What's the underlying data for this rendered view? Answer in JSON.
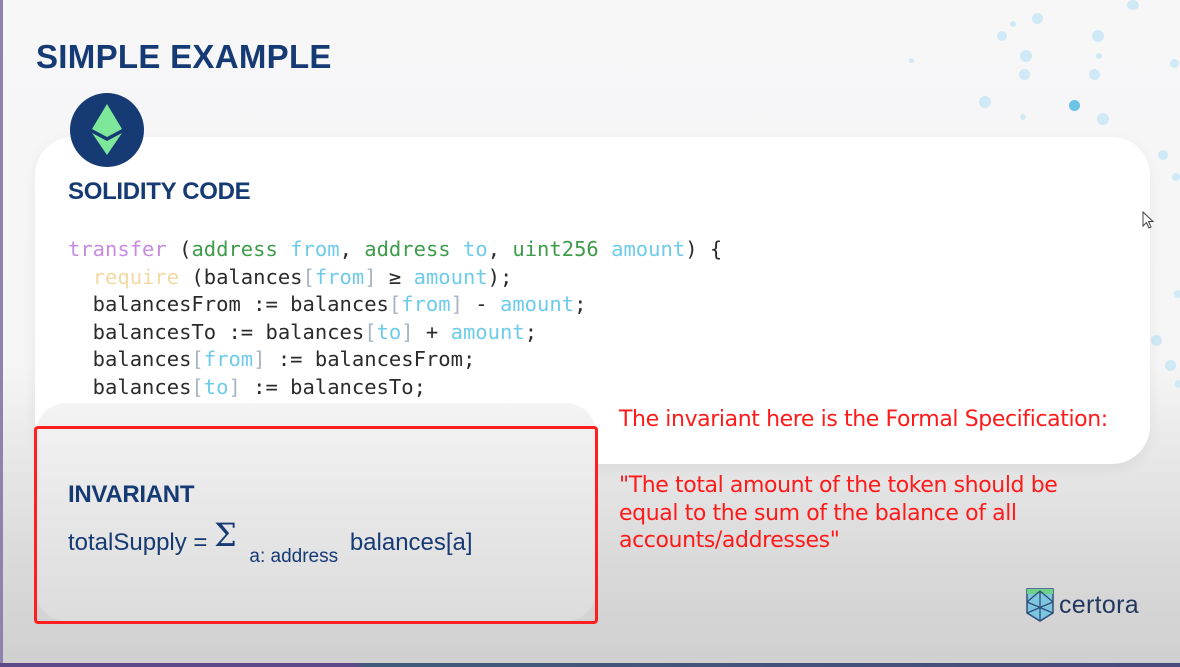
{
  "slide": {
    "title": "SIMPLE EXAMPLE",
    "code_section": {
      "heading": "SOLIDITY CODE",
      "lines": [
        [
          {
            "t": "transfer",
            "c": "c-fn"
          },
          {
            "t": " (",
            "c": ""
          },
          {
            "t": "address",
            "c": "c-type"
          },
          {
            "t": " ",
            "c": ""
          },
          {
            "t": "from",
            "c": "c-var"
          },
          {
            "t": ", ",
            "c": ""
          },
          {
            "t": "address",
            "c": "c-type"
          },
          {
            "t": " ",
            "c": ""
          },
          {
            "t": "to",
            "c": "c-var"
          },
          {
            "t": ", ",
            "c": ""
          },
          {
            "t": "uint256",
            "c": "c-type"
          },
          {
            "t": " ",
            "c": ""
          },
          {
            "t": "amount",
            "c": "c-var"
          },
          {
            "t": ") {",
            "c": ""
          }
        ],
        [
          {
            "t": "  ",
            "c": ""
          },
          {
            "t": "require",
            "c": "c-req"
          },
          {
            "t": " (balances",
            "c": ""
          },
          {
            "t": "[",
            "c": "c-brk"
          },
          {
            "t": "from",
            "c": "c-var"
          },
          {
            "t": "]",
            "c": "c-brk"
          },
          {
            "t": " ≥ ",
            "c": ""
          },
          {
            "t": "amount",
            "c": "c-var"
          },
          {
            "t": ");",
            "c": ""
          }
        ],
        [
          {
            "t": "  balancesFrom := balances",
            "c": ""
          },
          {
            "t": "[",
            "c": "c-brk"
          },
          {
            "t": "from",
            "c": "c-var"
          },
          {
            "t": "]",
            "c": "c-brk"
          },
          {
            "t": " - ",
            "c": ""
          },
          {
            "t": "amount",
            "c": "c-var"
          },
          {
            "t": ";",
            "c": ""
          }
        ],
        [
          {
            "t": "  balancesTo := balances",
            "c": ""
          },
          {
            "t": "[",
            "c": "c-brk"
          },
          {
            "t": "to",
            "c": "c-var"
          },
          {
            "t": "]",
            "c": "c-brk"
          },
          {
            "t": " + ",
            "c": ""
          },
          {
            "t": "amount",
            "c": "c-var"
          },
          {
            "t": ";",
            "c": ""
          }
        ],
        [
          {
            "t": "  balances",
            "c": ""
          },
          {
            "t": "[",
            "c": "c-brk"
          },
          {
            "t": "from",
            "c": "c-var"
          },
          {
            "t": "]",
            "c": "c-brk"
          },
          {
            "t": " := balancesFrom;",
            "c": ""
          }
        ],
        [
          {
            "t": "  balances",
            "c": ""
          },
          {
            "t": "[",
            "c": "c-brk"
          },
          {
            "t": "to",
            "c": "c-var"
          },
          {
            "t": "]",
            "c": "c-brk"
          },
          {
            "t": " := balancesTo;",
            "c": ""
          }
        ],
        [
          {
            "t": "}",
            "c": ""
          }
        ]
      ]
    },
    "invariant_section": {
      "heading": "INVARIANT",
      "formula_lhs": "totalSupply =",
      "sigma": "Σ",
      "subscript": "a: address",
      "formula_rhs": "balances[a]"
    },
    "annotation": {
      "line1": "The invariant here is the Formal Specification:",
      "quote": [
        "\"The total amount of the token should be",
        "equal to the sum of the balance of all",
        "accounts/addresses\""
      ]
    },
    "brand": {
      "name": "certora",
      "logo_icon": "certora-shield-icon",
      "chain_icon": "ethereum-icon"
    }
  },
  "colors": {
    "heading_navy": "#163a74",
    "eth_green": "#7ee89a",
    "annotation_red": "#ff1a1a",
    "highlight_box": "#ff1f1f"
  }
}
